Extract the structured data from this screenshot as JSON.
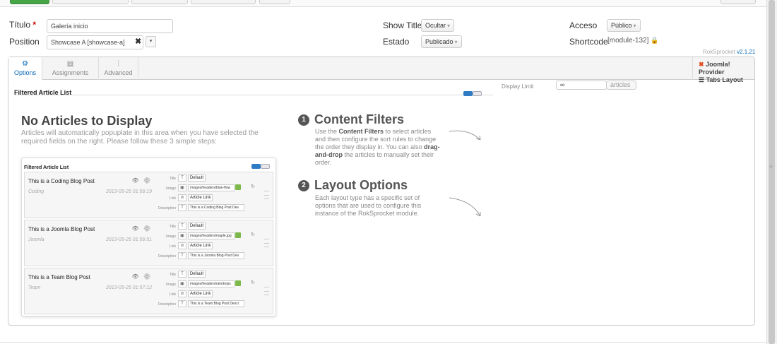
{
  "colors": {
    "accent": "#0a6ab5",
    "required": "#cc0000",
    "green": "#46a546"
  },
  "form": {
    "titulo_label": "Título",
    "titulo_value": "Galería inicio",
    "position_label": "Position",
    "position_value": "Showcase A [showcase-a]",
    "show_title_label": "Show Title",
    "show_title_value": "Ocultar",
    "estado_label": "Estado",
    "estado_value": "Publicado",
    "acceso_label": "Acceso",
    "acceso_value": "Público",
    "shortcode_label": "Shortcode",
    "shortcode_value": "[module-132]",
    "version_prefix": "RokSprocket",
    "version": "v2.1.21"
  },
  "tabs": [
    {
      "label": "Options",
      "icon": "gear-icon"
    },
    {
      "label": "Assignments",
      "icon": "list-icon"
    },
    {
      "label": "Advanced",
      "icon": "sliders-icon"
    }
  ],
  "provider": {
    "line1": "Joomla! Provider",
    "line2": "Tabs Layout"
  },
  "main": {
    "section_title": "Filtered Article List",
    "display_limit_label": "Display Limit",
    "display_limit_value": "∞",
    "display_limit_unit": "articles",
    "empty_title": "No Articles to Display",
    "empty_text": "Articles will automatically popuplate in this area when you have selected the required fields on the right. Please follow these 3 simple steps:"
  },
  "steps": [
    {
      "num": "1",
      "title": "Content Filters",
      "pre": "Use the ",
      "bold1": "Content Filters",
      "mid": " to select articles and then configure the sort rules to change the order they display in. You can also ",
      "bold2": "drag-and-drop",
      "post": " the articles to manually set their order."
    },
    {
      "num": "2",
      "title": "Layout Options",
      "text": "Each layout type has a specific set of options that are used to configure this instance of the RokSprocket module."
    }
  ],
  "preview": {
    "title": "Filtered Article List",
    "field_labels": {
      "title": "Title",
      "image": "Image",
      "link": "Link",
      "description": "Description"
    },
    "title_value": "Default",
    "link_value": "Article Link",
    "articles": [
      {
        "title": "This is a Coding Blog Post",
        "category": "Coding",
        "date": "2013-05-25 01:56:19",
        "image": "images/headers/blue-flow",
        "description": "This is a Coding Blog Post Des"
      },
      {
        "title": "This is a Joomla Blog Post",
        "category": "Joomla",
        "date": "2013-05-25 01:56:51",
        "image": "images/headers/maple.jpg",
        "description": "This is a Joomla Blog Post Des"
      },
      {
        "title": "This is a Team Blog Post",
        "category": "Team",
        "date": "2013-05-25 01:57:12",
        "image": "images/headers/raindrops",
        "description": "This is a Team Blog Post Desci"
      }
    ]
  }
}
